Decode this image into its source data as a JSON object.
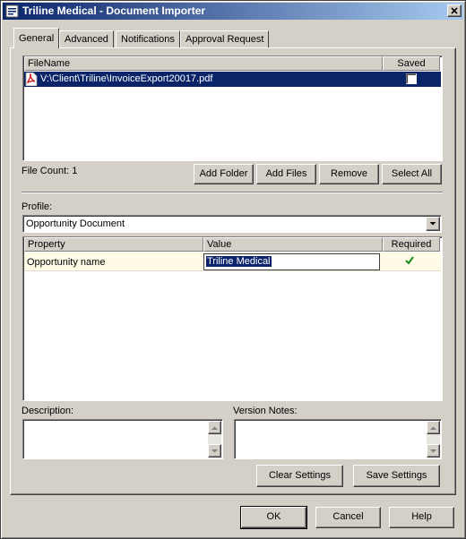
{
  "window": {
    "title": "Triline Medical - Document Importer"
  },
  "tabs": [
    {
      "label": "General",
      "active": true
    },
    {
      "label": "Advanced",
      "active": false
    },
    {
      "label": "Notifications",
      "active": false
    },
    {
      "label": "Approval Request",
      "active": false
    }
  ],
  "files": {
    "columns": {
      "filename": "FileName",
      "saved": "Saved"
    },
    "rows": [
      {
        "filename": "V:\\Client\\Triline\\InvoiceExport20017.pdf",
        "icon": "pdf-icon",
        "saved": false,
        "selected": true
      }
    ],
    "count_label": "File Count: 1"
  },
  "file_buttons": {
    "add_folder": "Add Folder",
    "add_files": "Add Files",
    "remove": "Remove",
    "select_all": "Select All"
  },
  "profile": {
    "label": "Profile:",
    "selected": "Opportunity Document"
  },
  "properties": {
    "columns": {
      "property": "Property",
      "value": "Value",
      "required": "Required"
    },
    "rows": [
      {
        "property": "Opportunity name",
        "value": "Triline Medical",
        "required": true
      }
    ]
  },
  "description": {
    "label": "Description:",
    "value": ""
  },
  "version_notes": {
    "label": "Version Notes:",
    "value": ""
  },
  "settings_buttons": {
    "clear": "Clear Settings",
    "save": "Save Settings"
  },
  "dialog_buttons": {
    "ok": "OK",
    "cancel": "Cancel",
    "help": "Help"
  },
  "colors": {
    "title_start": "#0a246a",
    "title_end": "#a6caf0",
    "selection": "#0a246a",
    "row_highlight": "#fffbe6",
    "check_green": "#1a8a1a",
    "pdf_red": "#cc0000"
  }
}
